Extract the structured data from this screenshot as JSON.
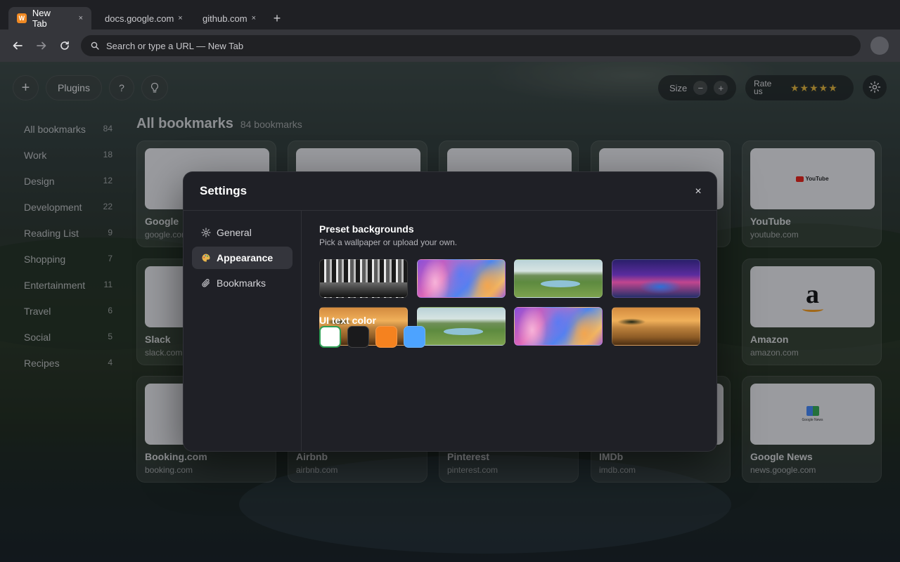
{
  "browser": {
    "tabs": [
      {
        "label": "New Tab",
        "favicon": "W",
        "active": true
      },
      {
        "label": "docs.google.com",
        "active": false
      },
      {
        "label": "github.com",
        "active": false
      }
    ],
    "new_tab_symbol": "+",
    "close_symbol": "×",
    "omnibox_placeholder": "Search or type a URL — New Tab"
  },
  "toolbar": {
    "add_symbol": "+",
    "plugins_label": "Plugins",
    "help_symbol": "?",
    "size_label": "Size",
    "size_minus": "−",
    "size_plus": "+",
    "rate_label": "Rate us",
    "rating_stars": 5,
    "stars_text": "★★★★★"
  },
  "sidebar": {
    "items": [
      {
        "label": "All bookmarks",
        "count": "84"
      },
      {
        "label": "Work",
        "count": "18"
      },
      {
        "label": "Design",
        "count": "12"
      },
      {
        "label": "Development",
        "count": "22"
      },
      {
        "label": "Reading List",
        "count": "9"
      },
      {
        "label": "Shopping",
        "count": "7"
      },
      {
        "label": "Entertainment",
        "count": "11"
      },
      {
        "label": "Travel",
        "count": "6"
      },
      {
        "label": "Social",
        "count": "5"
      },
      {
        "label": "Recipes",
        "count": "4"
      }
    ]
  },
  "main": {
    "title": "All bookmarks",
    "subtitle": "84 bookmarks",
    "bookmarks": [
      {
        "name": "Google",
        "url": "google.com"
      },
      {
        "name": "YouTube",
        "url": "youtube.com",
        "thumb_text": "YouTube"
      },
      {
        "name": "Slack",
        "url": "slack.com"
      },
      {
        "name": "Amazon",
        "url": "amazon.com",
        "thumb_text": "a"
      },
      {
        "name": "Booking.com",
        "url": "booking.com"
      },
      {
        "name": "Airbnb",
        "url": "airbnb.com"
      },
      {
        "name": "Pinterest",
        "url": "pinterest.com"
      },
      {
        "name": "IMDb",
        "url": "imdb.com"
      },
      {
        "name": "Google News",
        "url": "news.google.com",
        "thumb_text": "Google News"
      }
    ]
  },
  "settings": {
    "title": "Settings",
    "close_symbol": "×",
    "nav": [
      {
        "label": "General",
        "icon": "gear-icon"
      },
      {
        "label": "Appearance",
        "icon": "palette-icon",
        "active": true
      },
      {
        "label": "Bookmarks",
        "icon": "paperclip-icon"
      }
    ],
    "backgrounds_title": "Preset backgrounds",
    "backgrounds_desc": "Pick a wallpaper or upload your own.",
    "wallpapers": [
      "city-bw",
      "abstract-swirl",
      "green-valley-river",
      "neon-car",
      "savanna-sunset",
      "green-valley-river",
      "abstract-swirl",
      "savanna-sunset"
    ],
    "text_color_title": "UI text color",
    "text_colors": [
      "#ffffff",
      "#1a1a1c",
      "#f5821f",
      "#4da3ff"
    ],
    "selected_text_color": "#ffffff"
  }
}
